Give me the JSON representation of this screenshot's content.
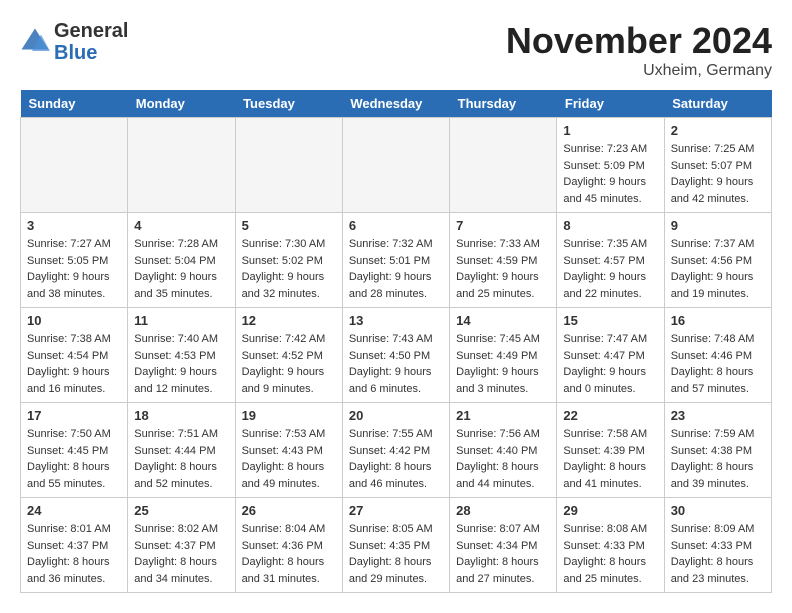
{
  "header": {
    "logo_line1": "General",
    "logo_line2": "Blue",
    "month": "November 2024",
    "location": "Uxheim, Germany"
  },
  "weekdays": [
    "Sunday",
    "Monday",
    "Tuesday",
    "Wednesday",
    "Thursday",
    "Friday",
    "Saturday"
  ],
  "weeks": [
    [
      {
        "day": "",
        "info": ""
      },
      {
        "day": "",
        "info": ""
      },
      {
        "day": "",
        "info": ""
      },
      {
        "day": "",
        "info": ""
      },
      {
        "day": "",
        "info": ""
      },
      {
        "day": "1",
        "info": "Sunrise: 7:23 AM\nSunset: 5:09 PM\nDaylight: 9 hours\nand 45 minutes."
      },
      {
        "day": "2",
        "info": "Sunrise: 7:25 AM\nSunset: 5:07 PM\nDaylight: 9 hours\nand 42 minutes."
      }
    ],
    [
      {
        "day": "3",
        "info": "Sunrise: 7:27 AM\nSunset: 5:05 PM\nDaylight: 9 hours\nand 38 minutes."
      },
      {
        "day": "4",
        "info": "Sunrise: 7:28 AM\nSunset: 5:04 PM\nDaylight: 9 hours\nand 35 minutes."
      },
      {
        "day": "5",
        "info": "Sunrise: 7:30 AM\nSunset: 5:02 PM\nDaylight: 9 hours\nand 32 minutes."
      },
      {
        "day": "6",
        "info": "Sunrise: 7:32 AM\nSunset: 5:01 PM\nDaylight: 9 hours\nand 28 minutes."
      },
      {
        "day": "7",
        "info": "Sunrise: 7:33 AM\nSunset: 4:59 PM\nDaylight: 9 hours\nand 25 minutes."
      },
      {
        "day": "8",
        "info": "Sunrise: 7:35 AM\nSunset: 4:57 PM\nDaylight: 9 hours\nand 22 minutes."
      },
      {
        "day": "9",
        "info": "Sunrise: 7:37 AM\nSunset: 4:56 PM\nDaylight: 9 hours\nand 19 minutes."
      }
    ],
    [
      {
        "day": "10",
        "info": "Sunrise: 7:38 AM\nSunset: 4:54 PM\nDaylight: 9 hours\nand 16 minutes."
      },
      {
        "day": "11",
        "info": "Sunrise: 7:40 AM\nSunset: 4:53 PM\nDaylight: 9 hours\nand 12 minutes."
      },
      {
        "day": "12",
        "info": "Sunrise: 7:42 AM\nSunset: 4:52 PM\nDaylight: 9 hours\nand 9 minutes."
      },
      {
        "day": "13",
        "info": "Sunrise: 7:43 AM\nSunset: 4:50 PM\nDaylight: 9 hours\nand 6 minutes."
      },
      {
        "day": "14",
        "info": "Sunrise: 7:45 AM\nSunset: 4:49 PM\nDaylight: 9 hours\nand 3 minutes."
      },
      {
        "day": "15",
        "info": "Sunrise: 7:47 AM\nSunset: 4:47 PM\nDaylight: 9 hours\nand 0 minutes."
      },
      {
        "day": "16",
        "info": "Sunrise: 7:48 AM\nSunset: 4:46 PM\nDaylight: 8 hours\nand 57 minutes."
      }
    ],
    [
      {
        "day": "17",
        "info": "Sunrise: 7:50 AM\nSunset: 4:45 PM\nDaylight: 8 hours\nand 55 minutes."
      },
      {
        "day": "18",
        "info": "Sunrise: 7:51 AM\nSunset: 4:44 PM\nDaylight: 8 hours\nand 52 minutes."
      },
      {
        "day": "19",
        "info": "Sunrise: 7:53 AM\nSunset: 4:43 PM\nDaylight: 8 hours\nand 49 minutes."
      },
      {
        "day": "20",
        "info": "Sunrise: 7:55 AM\nSunset: 4:42 PM\nDaylight: 8 hours\nand 46 minutes."
      },
      {
        "day": "21",
        "info": "Sunrise: 7:56 AM\nSunset: 4:40 PM\nDaylight: 8 hours\nand 44 minutes."
      },
      {
        "day": "22",
        "info": "Sunrise: 7:58 AM\nSunset: 4:39 PM\nDaylight: 8 hours\nand 41 minutes."
      },
      {
        "day": "23",
        "info": "Sunrise: 7:59 AM\nSunset: 4:38 PM\nDaylight: 8 hours\nand 39 minutes."
      }
    ],
    [
      {
        "day": "24",
        "info": "Sunrise: 8:01 AM\nSunset: 4:37 PM\nDaylight: 8 hours\nand 36 minutes."
      },
      {
        "day": "25",
        "info": "Sunrise: 8:02 AM\nSunset: 4:37 PM\nDaylight: 8 hours\nand 34 minutes."
      },
      {
        "day": "26",
        "info": "Sunrise: 8:04 AM\nSunset: 4:36 PM\nDaylight: 8 hours\nand 31 minutes."
      },
      {
        "day": "27",
        "info": "Sunrise: 8:05 AM\nSunset: 4:35 PM\nDaylight: 8 hours\nand 29 minutes."
      },
      {
        "day": "28",
        "info": "Sunrise: 8:07 AM\nSunset: 4:34 PM\nDaylight: 8 hours\nand 27 minutes."
      },
      {
        "day": "29",
        "info": "Sunrise: 8:08 AM\nSunset: 4:33 PM\nDaylight: 8 hours\nand 25 minutes."
      },
      {
        "day": "30",
        "info": "Sunrise: 8:09 AM\nSunset: 4:33 PM\nDaylight: 8 hours\nand 23 minutes."
      }
    ]
  ]
}
